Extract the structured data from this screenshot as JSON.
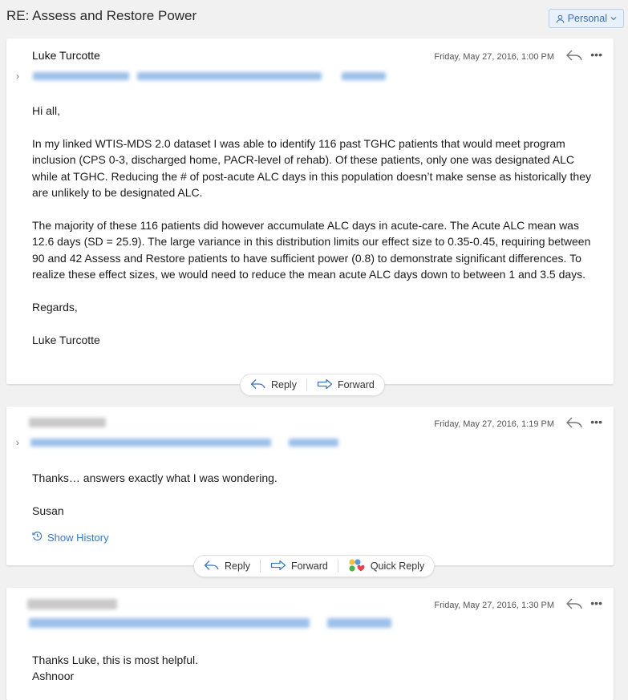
{
  "thread": {
    "title": "RE: Assess and Restore Power",
    "category": "Personal"
  },
  "messages": [
    {
      "sender": "Luke Turcotte",
      "date": "Friday, May 27, 2016, 1:00 PM",
      "paragraphs": [
        "Hi all,",
        "In my linked WTIS-MDS 2.0 dataset I was able to identify 116 past TGHC patients that would meet program inclusion (CPS 0-3, discharged home, PACR-level of rehab). Of these patients, only one was designated ALC while at TGHC. Reducing the # of post-acute ALC days in this population doesn’t make sense as historically they are unlikely to be designated ALC.",
        "The majority of these 116 patients did however accumulate ALC days in acute-care. The Acute ALC mean was 12.6 days (SD = 25.9). The large variance in this distribution limits our effect size to 0.35-0.45, requiring between 90 and 42 Assess and Restore patients to have sufficient power (0.8) to demonstrate significant differences. To realize these effect sizes, we would need to reduce the mean acute ALC days down to between 1 and 3.5 days.",
        "Regards,",
        "Luke Turcotte"
      ],
      "actions": {
        "reply": "Reply",
        "forward": "Forward"
      }
    },
    {
      "date": "Friday, May 27, 2016, 1:19 PM",
      "paragraphs": [
        "Thanks… answers exactly what I was wondering.",
        "Susan"
      ],
      "show_history": "Show History",
      "actions": {
        "reply": "Reply",
        "forward": "Forward",
        "quick_reply": "Quick Reply"
      }
    },
    {
      "date": "Friday, May 27, 2016, 1:30 PM",
      "lines": [
        "Thanks Luke, this is most helpful.",
        "Ashnoor"
      ]
    }
  ],
  "colors": {
    "accent": "#3a78c0",
    "background": "#f1f1f1",
    "card": "#ffffff"
  }
}
